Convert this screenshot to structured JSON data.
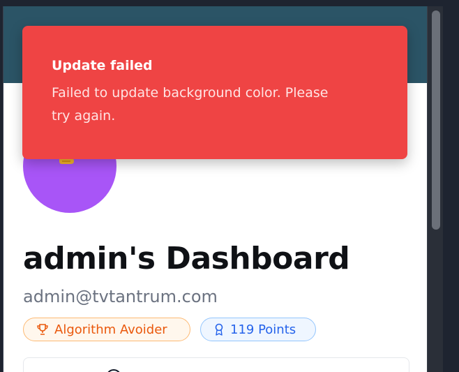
{
  "toast": {
    "title": "Update failed",
    "description": "Failed to update background color. Please try again.",
    "color": "#ef4444"
  },
  "profile": {
    "title": "admin's Dashboard",
    "email": "admin@tvtantrum.com",
    "avatar_color": "#a855f7",
    "header_color": "#2b5466"
  },
  "badges": {
    "achievement": {
      "label": "Algorithm Avoider",
      "icon": "trophy-icon",
      "color": "#ea580c"
    },
    "points": {
      "label": "119 Points",
      "icon": "award-ribbon-icon",
      "color": "#2563eb"
    }
  }
}
